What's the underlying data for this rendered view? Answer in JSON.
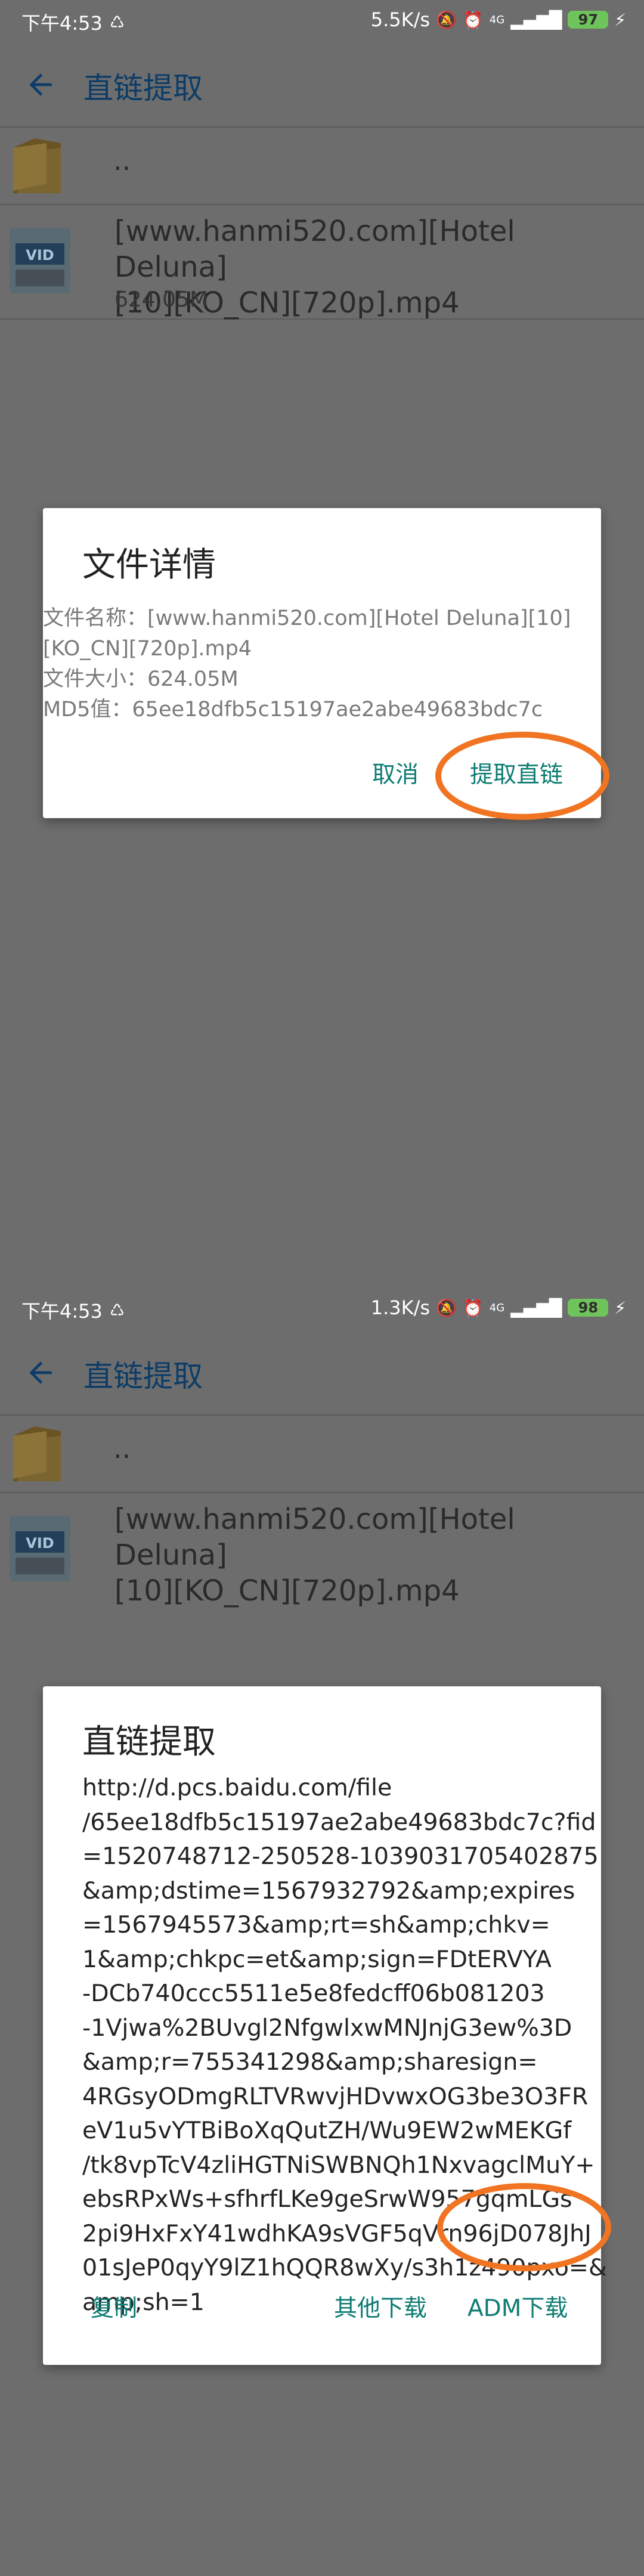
{
  "screen1": {
    "status": {
      "time": "下午4:53",
      "speed": "5.5K/s",
      "signal": "4G",
      "battery": "97",
      "battery_color": "#6ec45a"
    },
    "appbar": {
      "title": "直链提取",
      "back_icon": "arrow-left-icon"
    },
    "list": {
      "parent_label": "..",
      "file_name_line1": "[www.hanmi520.com][Hotel Deluna]",
      "file_name_line2": "[10][KO_CN][720p].mp4",
      "file_size": "624.05M",
      "file_badge": "VID"
    },
    "dialog": {
      "title": "文件详情",
      "lines": [
        "文件名称：[www.hanmi520.com][Hotel Deluna][10]",
        "[KO_CN][720p].mp4",
        "文件大小：624.05M",
        "MD5值：65ee18dfb5c15197ae2abe49683bdc7c"
      ],
      "cancel_label": "取消",
      "extract_label": "提取直链"
    },
    "accent_color": "#0d7c73",
    "highlight_color": "#f07421"
  },
  "screen2": {
    "status": {
      "time": "下午4:53",
      "speed": "1.3K/s",
      "signal": "4G",
      "battery": "98",
      "battery_color": "#6ec45a"
    },
    "appbar": {
      "title": "直链提取",
      "back_icon": "arrow-left-icon"
    },
    "list": {
      "parent_label": "..",
      "file_name_line1": "[www.hanmi520.com][Hotel Deluna]",
      "file_name_line2": "[10][KO_CN][720p].mp4",
      "file_badge": "VID"
    },
    "dialog": {
      "title": "直链提取",
      "link_lines": [
        "http://d.pcs.baidu.com/file",
        "/65ee18dfb5c15197ae2abe49683bdc7c?fid",
        "=1520748712-250528-1039031705402875",
        "&amp;dstime=1567932792&amp;expires",
        "=1567945573&amp;rt=sh&amp;chkv=",
        "1&amp;chkpc=et&amp;sign=FDtERVYA",
        "-DCb740ccc5511e5e8fedcff06b081203",
        "-1Vjwa%2BUvgl2NfgwlxwMNJnjG3ew%3D",
        "&amp;r=755341298&amp;sharesign=",
        "4RGsyODmgRLTVRwvjHDvwxOG3be3O3FR",
        "eV1u5vYTBiBoXqQutZH/Wu9EW2wMEKGf",
        "/tk8vpTcV4zliHGTNiSWBNQh1NxvagclMuY+",
        "ebsRPxWs+sfhrfLKe9geSrwW957gqmLGs",
        "2pi9HxFxY41wdhKA9sVGF5qVrn96jD078JhJ",
        "01sJeP0qyY9lZ1hQQR8wXy/s3h1z490pxo=&",
        "amp;sh=1"
      ],
      "copy_label": "复制",
      "other_download_label": "其他下载",
      "adm_label": "ADM下载"
    }
  }
}
